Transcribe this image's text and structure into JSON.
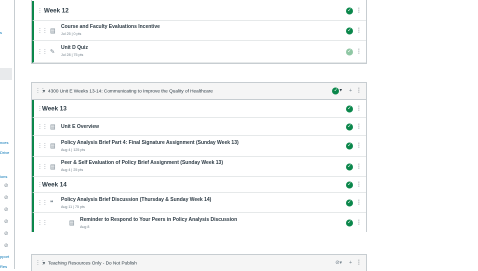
{
  "left_nav": {
    "partial_labels": [
      "s",
      "nces",
      "Drive",
      "ions",
      "pport",
      "Res"
    ]
  },
  "module_top": {
    "rows": [
      {
        "kind": "header",
        "title": "Week 12"
      },
      {
        "kind": "item",
        "title": "Course and Faculty Evaluations Incentive",
        "subtitle": "Jul 25  |  0 pts",
        "icon": "assignment-icon"
      },
      {
        "kind": "item",
        "title": "Unit D Quiz",
        "subtitle": "Jul 28  |  75 pts",
        "icon": "quiz-icon",
        "faded": true
      }
    ]
  },
  "module_e": {
    "title": "4300 Unit E Weeks 13-14: Communicating to Improve the Quality of Healthcare",
    "rows": [
      {
        "kind": "header",
        "title": "Week 13"
      },
      {
        "kind": "item",
        "title": "Unit E Overview",
        "subtitle": "",
        "icon": "page-icon"
      },
      {
        "kind": "item",
        "title": "Policy Analysis Brief Part 4: Final Signature Assignment (Sunday Week 13)",
        "subtitle": "Aug 4  |  125 pts",
        "icon": "assignment-icon"
      },
      {
        "kind": "item",
        "title": "Peer & Self Evaluation of Policy Brief Assignment (Sunday Week 13)",
        "subtitle": "Aug 4  |  25 pts",
        "icon": "assignment-icon"
      },
      {
        "kind": "header",
        "title": "Week 14"
      },
      {
        "kind": "item",
        "title": "Policy Analysis Brief Discussion (Thursday & Sunday Week 14)",
        "subtitle": "Aug 11  |  75 pts",
        "icon": "discussion-icon"
      },
      {
        "kind": "item",
        "title": "Reminder to Respond to Your Peers in Policy Analysis Discussion",
        "subtitle": "Aug 8",
        "icon": "page-icon",
        "indented": true
      }
    ]
  },
  "module_teaching": {
    "title": "Teaching Resources Only - Do Not Publish"
  },
  "colors": {
    "published_green": "#0b874b",
    "border": "#c7cdd1"
  }
}
